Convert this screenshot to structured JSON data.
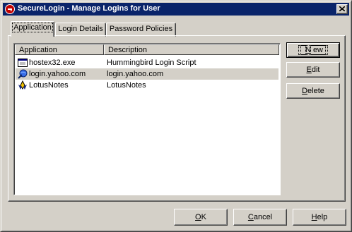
{
  "window": {
    "title": "SecureLogin - Manage Logins for User"
  },
  "tabs": [
    {
      "label": "Application"
    },
    {
      "label": "Login Details"
    },
    {
      "label": "Password Policies"
    }
  ],
  "list": {
    "columns": [
      "Application",
      "Description"
    ],
    "rows": [
      {
        "application": "hostex32.exe",
        "description": "Hummingbird Login Script",
        "icon": "window-app-icon"
      },
      {
        "application": "login.yahoo.com",
        "description": "login.yahoo.com",
        "icon": "web-globe-icon",
        "selected": true
      },
      {
        "application": "LotusNotes",
        "description": "LotusNotes",
        "icon": "lotus-notes-icon"
      }
    ]
  },
  "side_buttons": {
    "new": {
      "pre": "",
      "key": "N",
      "post": "ew"
    },
    "edit": {
      "pre": "",
      "key": "E",
      "post": "dit"
    },
    "delete": {
      "pre": "",
      "key": "D",
      "post": "elete"
    }
  },
  "bottom_buttons": {
    "ok": {
      "pre": "",
      "key": "O",
      "post": "K"
    },
    "cancel": {
      "pre": "",
      "key": "C",
      "post": "ancel"
    },
    "help": {
      "pre": "",
      "key": "H",
      "post": "elp"
    }
  },
  "colors": {
    "titlebar": "#0a246a",
    "face": "#d4d0c8",
    "selection": "#d4d0c8"
  }
}
